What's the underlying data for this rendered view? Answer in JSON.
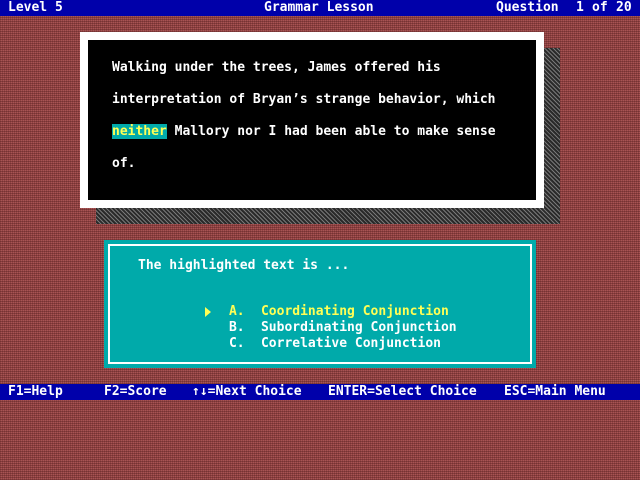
{
  "header": {
    "level": "Level 5",
    "title": "Grammar Lesson",
    "question_label": "Question",
    "question_number": "1",
    "of_label": "of",
    "total_questions": "20"
  },
  "passage": {
    "line1": "Walking under the trees, James offered his",
    "line2": "interpretation of Bryan’s strange behavior, which",
    "line3_highlight": "neither",
    "line3_rest": " Mallory nor I had been able to make sense",
    "line4": "of."
  },
  "question": {
    "prompt": "The highlighted text is ...",
    "choices": [
      {
        "letter": "A.",
        "label": "Coordinating Conjunction",
        "selected": true
      },
      {
        "letter": "B.",
        "label": "Subordinating Conjunction",
        "selected": false
      },
      {
        "letter": "C.",
        "label": "Correlative Conjunction",
        "selected": false
      }
    ]
  },
  "footer": {
    "f1": "F1=Help",
    "f2": "F2=Score",
    "next": "↑↓=Next Choice",
    "enter": "ENTER=Select Choice",
    "esc": "ESC=Main Menu"
  },
  "colors": {
    "bar_bg": "#0000aa",
    "highlight_bg": "#00aaaa",
    "selected_text": "#ffff55",
    "background": "#a85454"
  }
}
